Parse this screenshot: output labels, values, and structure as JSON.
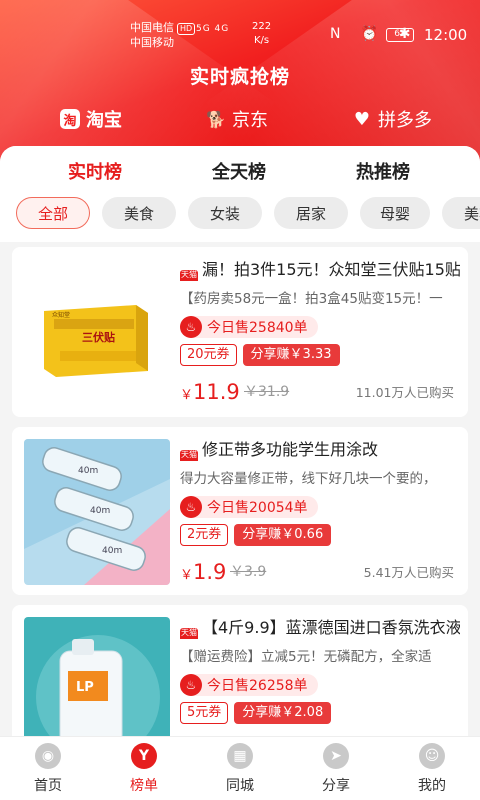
{
  "status": {
    "carrier1": "中国电信",
    "hd": "HD",
    "carrier2": "中国移动",
    "signal": "5G 4G",
    "speed": "222",
    "speed_unit": "K/s",
    "icons": "N ⏰ ✱",
    "battery": "62",
    "time": "12:00"
  },
  "header": {
    "title": "实时疯抢榜",
    "platforms": [
      {
        "label": "淘宝",
        "icon": "taobao-icon",
        "glyph": "淘"
      },
      {
        "label": "京东",
        "icon": "jd-dog-icon",
        "glyph": "🐕"
      },
      {
        "label": "拼多多",
        "icon": "pdd-heart-icon",
        "glyph": "♥"
      }
    ]
  },
  "rank_tabs": [
    "实时榜",
    "全天榜",
    "热推榜"
  ],
  "categories": [
    "全部",
    "美食",
    "女装",
    "居家",
    "母婴",
    "美妆"
  ],
  "products": [
    {
      "badge": "天猫",
      "title": "漏！拍3件15元！众知堂三伏贴15贴",
      "desc": "【药房卖58元一盒！拍3盒45贴变15元！一",
      "sold": "今日售25840单",
      "coupon": "20元券",
      "share": "分享赚￥3.33",
      "currency": "￥",
      "price": "11.9",
      "orig": "￥31.9",
      "bought": "11.01万人已购买"
    },
    {
      "badge": "天猫",
      "title": "修正带多功能学生用涂改",
      "desc": "得力大容量修正带，线下好几块一个要的，",
      "sold": "今日售20054单",
      "coupon": "2元券",
      "share": "分享赚￥0.66",
      "currency": "￥",
      "price": "1.9",
      "orig": "￥3.9",
      "bought": "5.41万人已购买"
    },
    {
      "badge": "天猫",
      "title": "【4斤9.9】蓝漂德国进口香氛洗衣液",
      "desc": "【赠运费险】立减5元！无磷配方，全家适",
      "sold": "今日售26258单",
      "coupon": "5元券",
      "share": "分享赚￥2.08"
    }
  ],
  "product_images": {
    "box_brand": "众知堂",
    "box_text": "三伏贴",
    "tape_label": "40m",
    "bottle_label": "LP"
  },
  "bottom_nav": [
    {
      "label": "首页",
      "icon": "home-icon"
    },
    {
      "label": "榜单",
      "icon": "ranking-icon"
    },
    {
      "label": "同城",
      "icon": "local-icon"
    },
    {
      "label": "分享",
      "icon": "share-icon"
    },
    {
      "label": "我的",
      "icon": "profile-icon"
    }
  ],
  "colors": {
    "accent": "#e61e1e",
    "header": "#f11f1f"
  }
}
